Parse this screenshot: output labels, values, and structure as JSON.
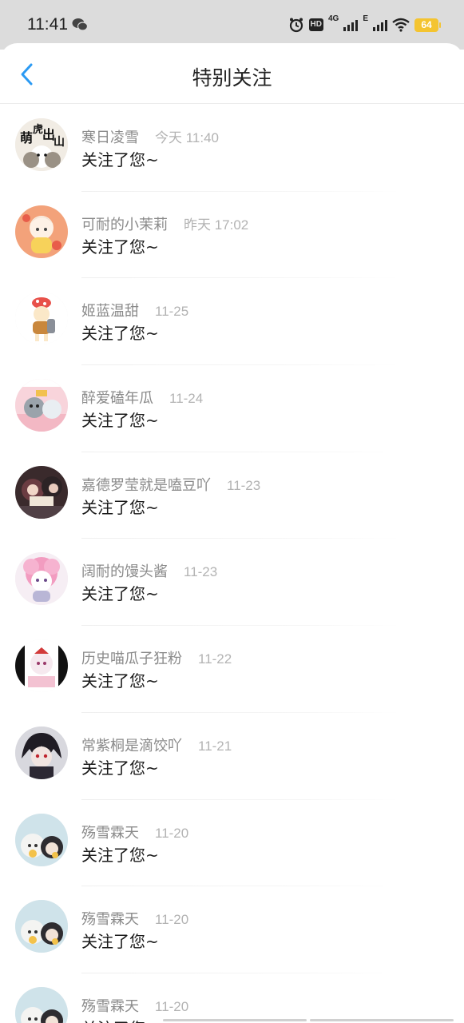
{
  "status_bar": {
    "time": "11:41",
    "hd": "HD",
    "net": "4G",
    "net2": "E",
    "battery": "64"
  },
  "header": {
    "title": "特别关注"
  },
  "items": [
    {
      "nick": "寒日凌雪",
      "time": "今天 11:40",
      "msg": "关注了您~",
      "avatar": "a1"
    },
    {
      "nick": "可耐的小茉莉",
      "time": "昨天 17:02",
      "msg": "关注了您~",
      "avatar": "a2"
    },
    {
      "nick": "姬蓝温甜",
      "time": "11-25",
      "msg": "关注了您~",
      "avatar": "a3"
    },
    {
      "nick": "醉爱磕年瓜",
      "time": "11-24",
      "msg": "关注了您~",
      "avatar": "a4"
    },
    {
      "nick": "嘉德罗莹就是嗑豆吖",
      "time": "11-23",
      "msg": "关注了您~",
      "avatar": "a5"
    },
    {
      "nick": "阔耐的馒头酱",
      "time": "11-23",
      "msg": "关注了您~",
      "avatar": "a6"
    },
    {
      "nick": "历史喵瓜子狂粉",
      "time": "11-22",
      "msg": "关注了您~",
      "avatar": "a7"
    },
    {
      "nick": "常紫桐是滴饺吖",
      "time": "11-21",
      "msg": "关注了您~",
      "avatar": "a8"
    },
    {
      "nick": "殇雪霖天",
      "time": "11-20",
      "msg": "关注了您~",
      "avatar": "a9"
    },
    {
      "nick": "殇雪霖天",
      "time": "11-20",
      "msg": "关注了您~",
      "avatar": "a9"
    },
    {
      "nick": "殇雪霖天",
      "time": "11-20",
      "msg": "关注了您~",
      "avatar": "a9"
    }
  ],
  "colors": {
    "accent": "#2b9af3",
    "status_bg": "#dcdcdc",
    "battery": "#f4c430"
  }
}
